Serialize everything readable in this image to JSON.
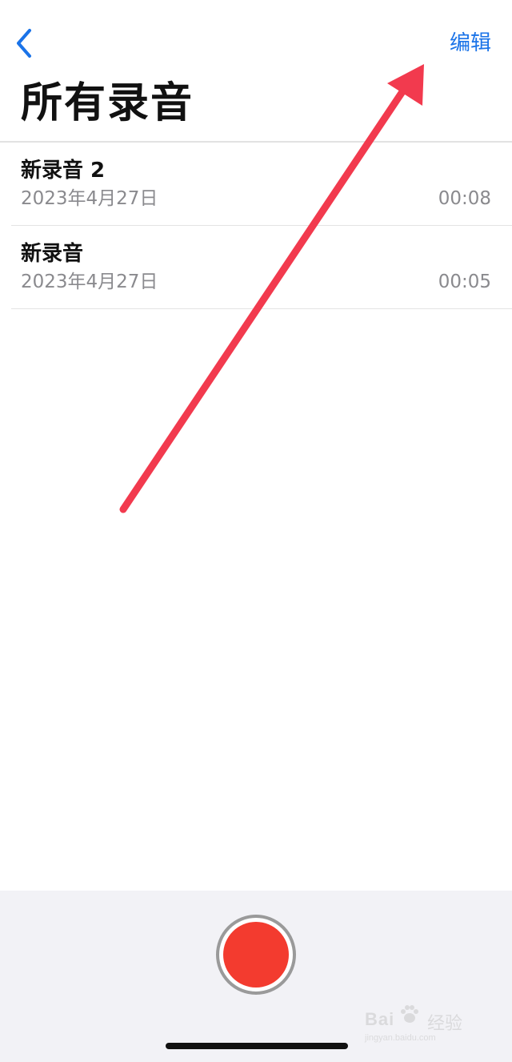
{
  "nav": {
    "edit_label": "编辑"
  },
  "title": "所有录音",
  "recordings": [
    {
      "name": "新录音 2",
      "date": "2023年4月27日",
      "duration": "00:08"
    },
    {
      "name": "新录音",
      "date": "2023年4月27日",
      "duration": "00:05"
    }
  ],
  "watermark": {
    "brand": "Bai",
    "brand_suffix": "经验",
    "url": "jingyan.baidu.com"
  },
  "colors": {
    "accent": "#1a73e8",
    "record": "#f33b2f",
    "annotation_arrow": "#f23a4e",
    "secondary_text": "#8a8a8e",
    "bottom_panel": "#f2f2f6"
  },
  "icons": {
    "back": "chevron-left-icon",
    "record": "record-icon",
    "annotation": "arrow-annotation"
  }
}
